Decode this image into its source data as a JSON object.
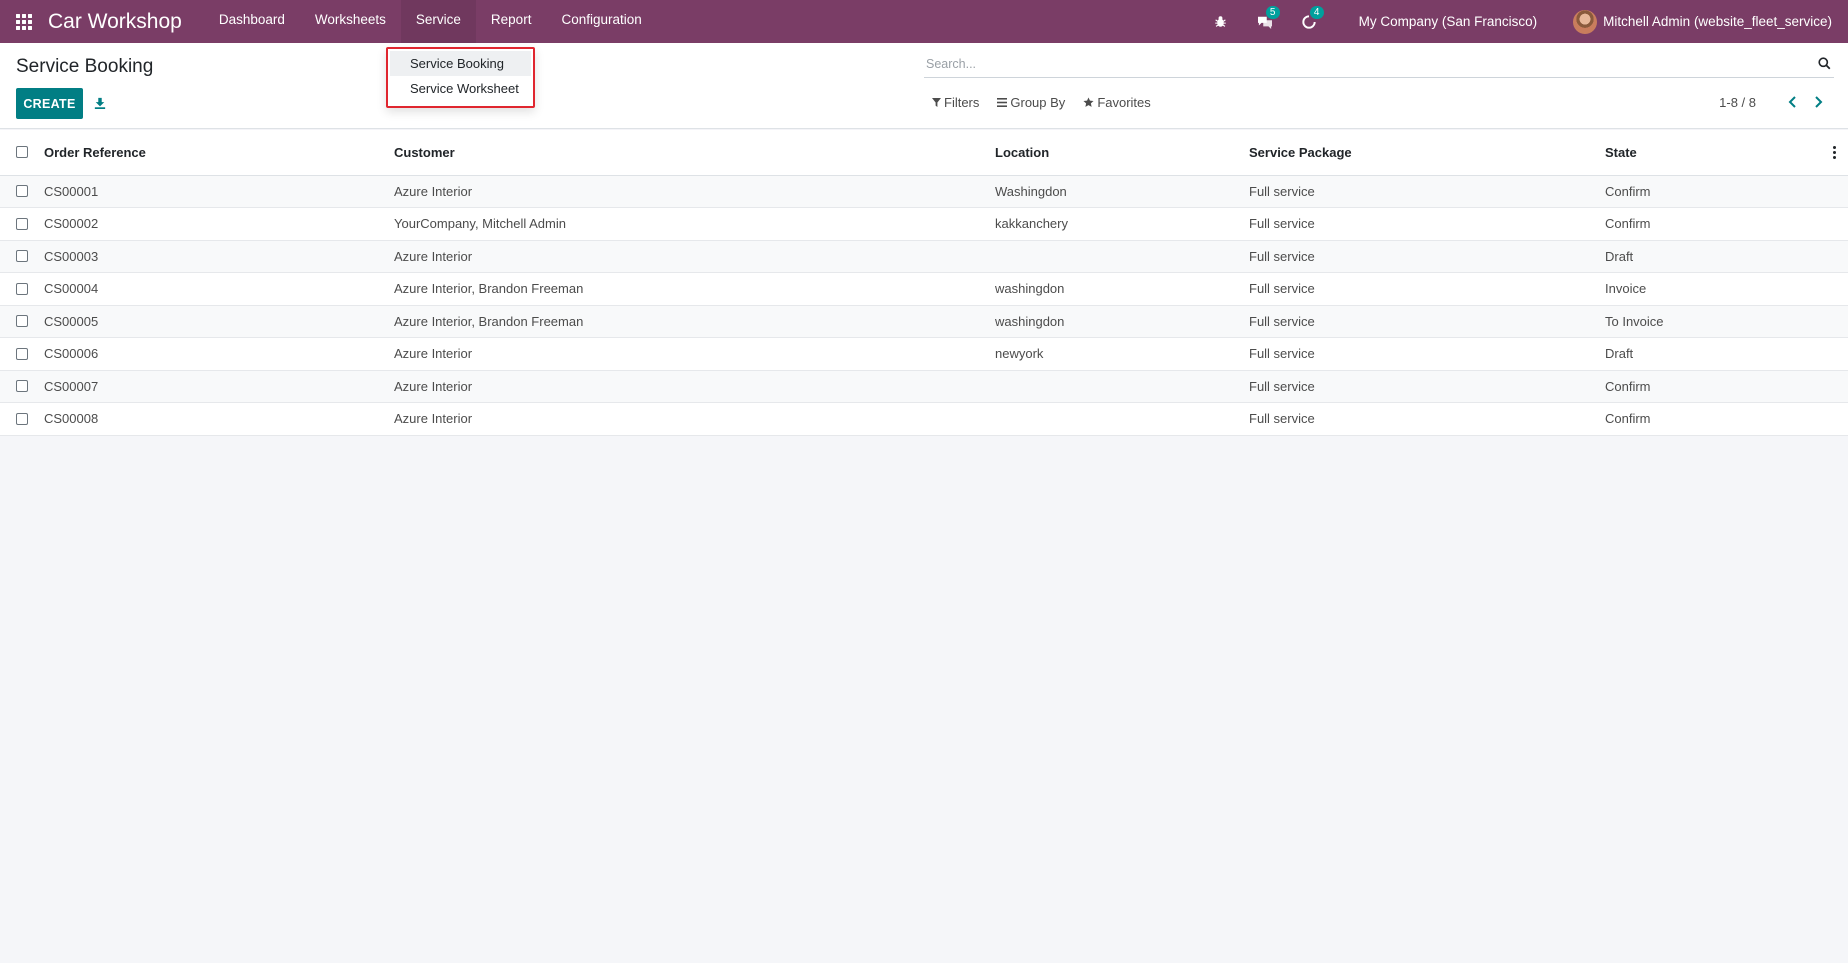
{
  "navbar": {
    "brand": "Car Workshop",
    "menu": [
      {
        "label": "Dashboard"
      },
      {
        "label": "Worksheets"
      },
      {
        "label": "Service"
      },
      {
        "label": "Report"
      },
      {
        "label": "Configuration"
      }
    ],
    "messages_badge": "5",
    "activities_badge": "4",
    "company": "My Company (San Francisco)",
    "user": "Mitchell Admin (website_fleet_service)"
  },
  "dropdown": {
    "items": [
      {
        "label": "Service Booking"
      },
      {
        "label": "Service Worksheet"
      }
    ]
  },
  "control_panel": {
    "title": "Service Booking",
    "create_label": "CREATE",
    "search_placeholder": "Search...",
    "filters_label": "Filters",
    "groupby_label": "Group By",
    "favorites_label": "Favorites",
    "pager": "1-8 / 8"
  },
  "table": {
    "headers": {
      "ref": "Order Reference",
      "customer": "Customer",
      "location": "Location",
      "package": "Service Package",
      "state": "State"
    },
    "rows": [
      {
        "ref": "CS00001",
        "customer": "Azure Interior",
        "location": "Washingdon",
        "package": "Full service",
        "state": "Confirm"
      },
      {
        "ref": "CS00002",
        "customer": "YourCompany, Mitchell Admin",
        "location": "kakkanchery",
        "package": "Full service",
        "state": "Confirm"
      },
      {
        "ref": "CS00003",
        "customer": "Azure Interior",
        "location": "",
        "package": "Full service",
        "state": "Draft"
      },
      {
        "ref": "CS00004",
        "customer": "Azure Interior, Brandon Freeman",
        "location": "washingdon",
        "package": "Full service",
        "state": "Invoice"
      },
      {
        "ref": "CS00005",
        "customer": "Azure Interior, Brandon Freeman",
        "location": "washingdon",
        "package": "Full service",
        "state": "To Invoice"
      },
      {
        "ref": "CS00006",
        "customer": "Azure Interior",
        "location": "newyork",
        "package": "Full service",
        "state": "Draft"
      },
      {
        "ref": "CS00007",
        "customer": "Azure Interior",
        "location": "",
        "package": "Full service",
        "state": "Confirm"
      },
      {
        "ref": "CS00008",
        "customer": "Azure Interior",
        "location": "",
        "package": "Full service",
        "state": "Confirm"
      }
    ]
  },
  "colors": {
    "navbar": "#7a3d66",
    "primary": "#017e84",
    "badge": "#00a09d",
    "highlight_border": "#e0262f"
  }
}
